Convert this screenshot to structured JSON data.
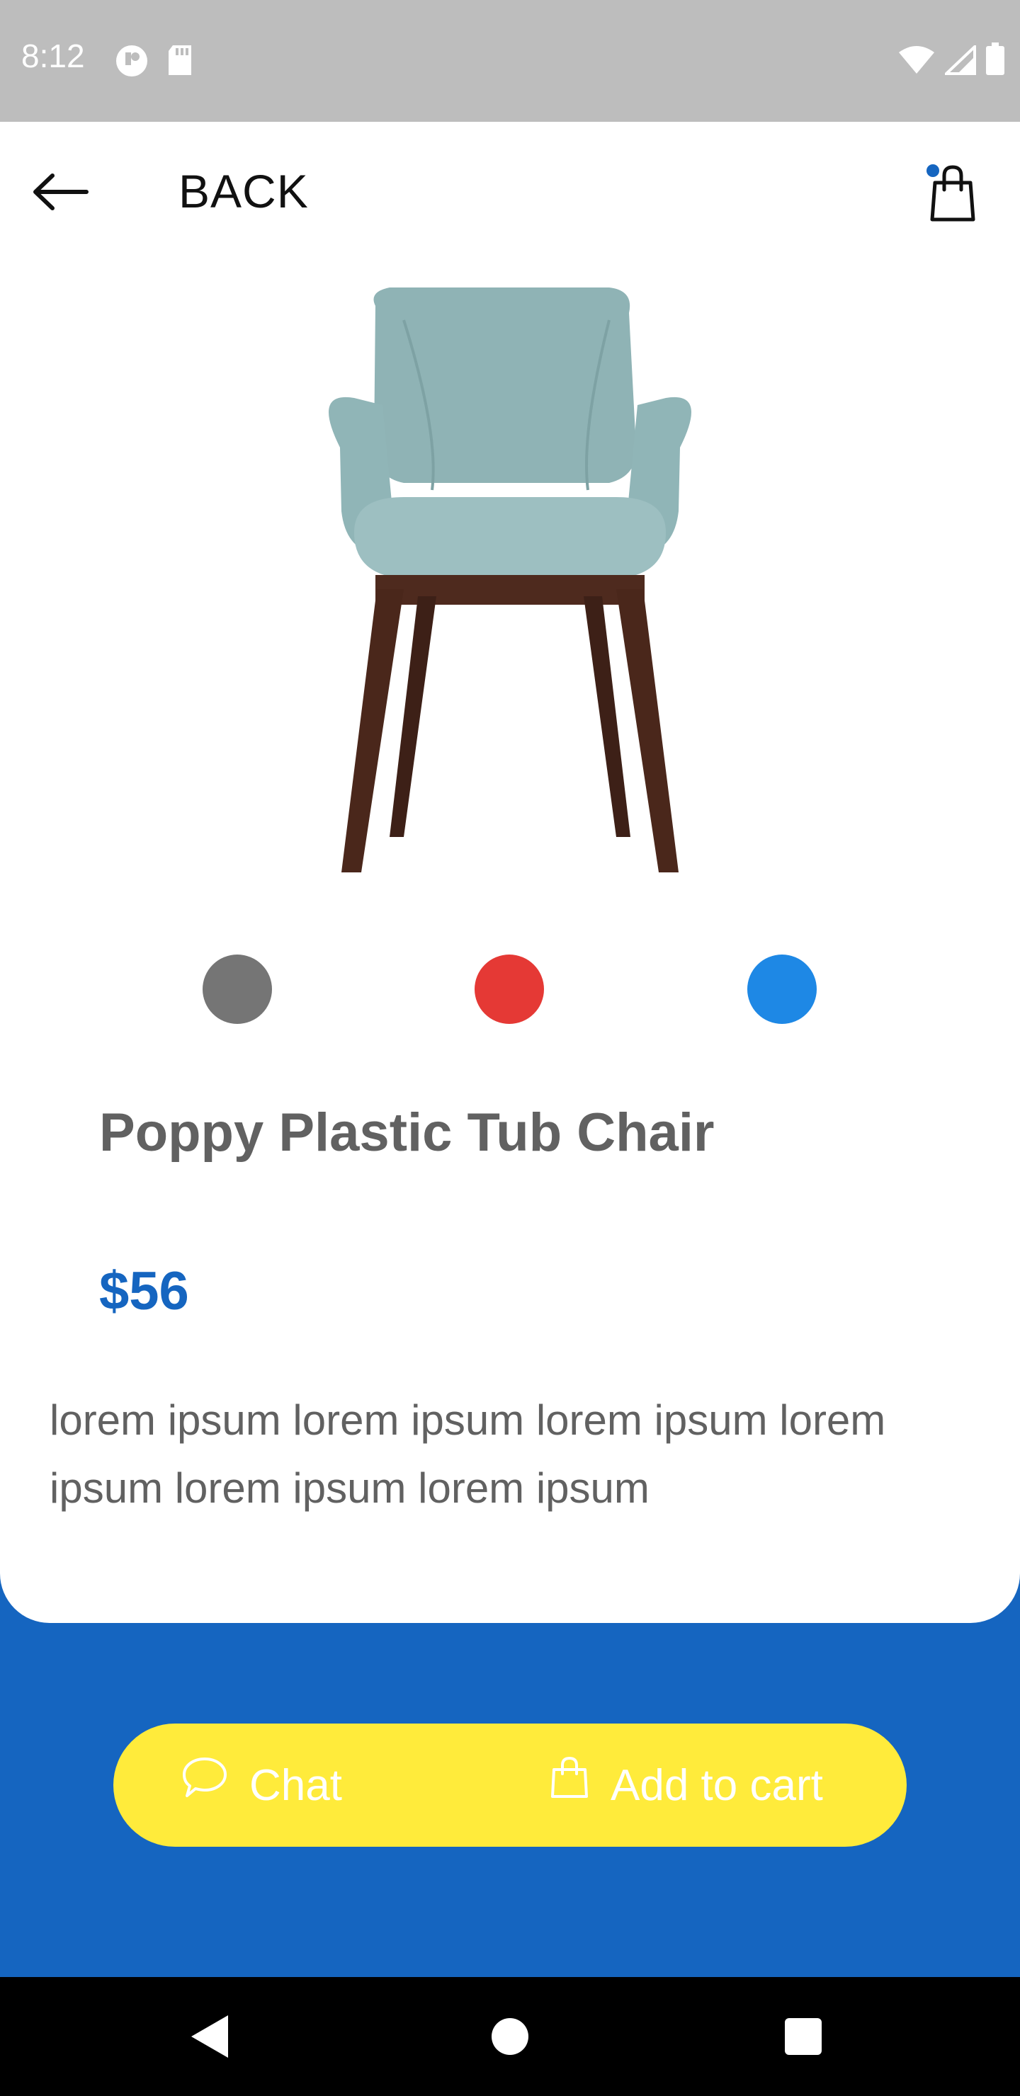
{
  "status_bar": {
    "time": "8:12",
    "icons": [
      "notification-icon",
      "sd-card-icon",
      "wifi-icon",
      "signal-icon",
      "battery-icon"
    ]
  },
  "header": {
    "back_label": "BACK",
    "icons": [
      "back-arrow-icon",
      "shopping-bag-icon"
    ],
    "cart_indicator_color": "#1565c0"
  },
  "product": {
    "title": "Poppy Plastic Tub Chair",
    "price": "$56",
    "description": "lorem ipsum lorem ipsum lorem ipsum lorem ipsum lorem ipsum lorem ipsum",
    "colors": [
      "#757575",
      "#e53935",
      "#1e88e5"
    ]
  },
  "actions": {
    "chat_label": "Chat",
    "add_to_cart_label": "Add to cart",
    "bar_color": "#ffeb3b",
    "background_color": "#1565c0"
  },
  "nav": {
    "icons": [
      "nav-back-icon",
      "nav-home-icon",
      "nav-recents-icon"
    ]
  }
}
